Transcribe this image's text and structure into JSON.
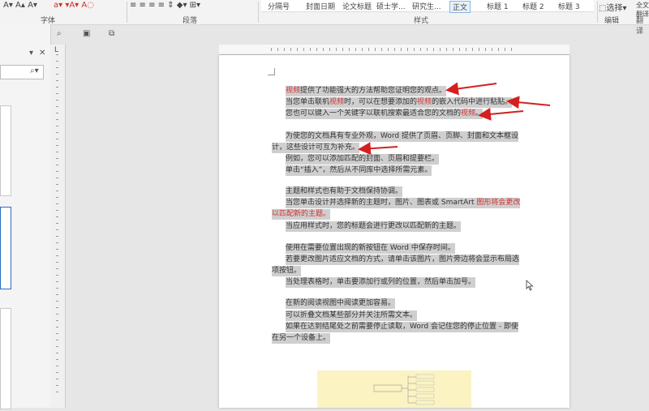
{
  "ribbon": {
    "groups": {
      "font": "字体",
      "paragraph": "段落",
      "styles": "样式",
      "editing": "编辑"
    },
    "styles": [
      "分隔号",
      "封面日期",
      "论文标题",
      "硕士学...",
      "研究生...",
      "正文",
      "标题 1",
      "标题 2",
      "标题 3"
    ],
    "selected_style": "正文",
    "select_label": "选择",
    "translate_label_1": "全文翻译",
    "translate_label_2": "翻译"
  },
  "document": {
    "lines": [
      [
        {
          "t": "视频",
          "c": "red"
        },
        {
          "t": "提供了功能强大的方法帮助您证明您的观点。"
        }
      ],
      [
        {
          "t": "当您单击联机"
        },
        {
          "t": "视频",
          "c": "red"
        },
        {
          "t": "时，可以在想要添加的"
        },
        {
          "t": "视频",
          "c": "red"
        },
        {
          "t": "的嵌入代码中进行粘贴。"
        }
      ],
      [
        {
          "t": "您也可以键入一个关键字以联机搜索最适合您的文档的"
        },
        {
          "t": "视频",
          "c": "red"
        },
        {
          "t": "。"
        }
      ],
      [
        {
          "t": "为使您的文档具有专业外观，Word 提供了页眉、页脚、封面和文本框设"
        }
      ],
      [
        {
          "t": "计，这些设计可互为补充。"
        }
      ],
      [
        {
          "t": "例如，您可以添加匹配的封面、页眉和提要栏。"
        }
      ],
      [
        {
          "t": "单击“插入”，然后从不同库中选择所需元素。"
        }
      ],
      [
        {
          "t": "主题和样式也有助于文档保持协调。"
        }
      ],
      [
        {
          "t": "当您单击设计并选择新的主题时，图片、图表或 SmartArt "
        },
        {
          "t": "图形将会更改",
          "c": "red"
        }
      ],
      [
        {
          "t": "以匹配新的主题。",
          "c": "red"
        }
      ],
      [
        {
          "t": "当应用样式时，您的标题会进行更改以匹配新的主题。"
        }
      ],
      [
        {
          "t": "使用在需要位置出现的新按钮在 Word 中保存时间。"
        }
      ],
      [
        {
          "t": "若要更改图片适应文档的方式，请单击该图片，图片旁边将会显示布局选"
        }
      ],
      [
        {
          "t": "项按钮。"
        }
      ],
      [
        {
          "t": "当处理表格时，单击要添加行或列的位置，然后单击加号。"
        }
      ],
      [
        {
          "t": "在新的阅读视图中阅读更加容易。"
        }
      ],
      [
        {
          "t": "可以折叠文档某些部分并关注所需文本。"
        }
      ],
      [
        {
          "t": "如果在达到结尾处之前需要停止读取，Word 会记住您的停止位置 - 即使"
        }
      ],
      [
        {
          "t": "在另一个设备上。"
        }
      ]
    ]
  }
}
